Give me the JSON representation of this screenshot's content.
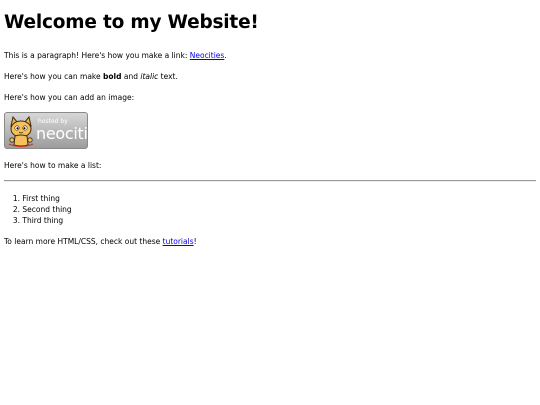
{
  "heading": "Welcome to my Website!",
  "para_link": {
    "prefix": "This is a paragraph! Here's how you make a link: ",
    "link_text": "Neocities",
    "suffix": "."
  },
  "para_format": {
    "prefix": "Here's how you can make ",
    "bold": "bold",
    "middle": " and ",
    "italic": "italic",
    "suffix": " text."
  },
  "para_image": "Here's how you can add an image:",
  "badge": {
    "small_text": "hosted by",
    "big_text": "neocities"
  },
  "para_list": "Here's how to make a list:",
  "list_items": [
    {
      "number": "1.",
      "text": "First thing"
    },
    {
      "number": "2.",
      "text": "Second thing"
    },
    {
      "number": "3.",
      "text": "Third thing"
    }
  ],
  "para_learn": {
    "prefix": "To learn more HTML/CSS, check out these ",
    "link_text": "tutorials",
    "suffix": "!"
  },
  "colors": {
    "link": "#0000ee",
    "text": "#000000",
    "background": "#ffffff"
  }
}
